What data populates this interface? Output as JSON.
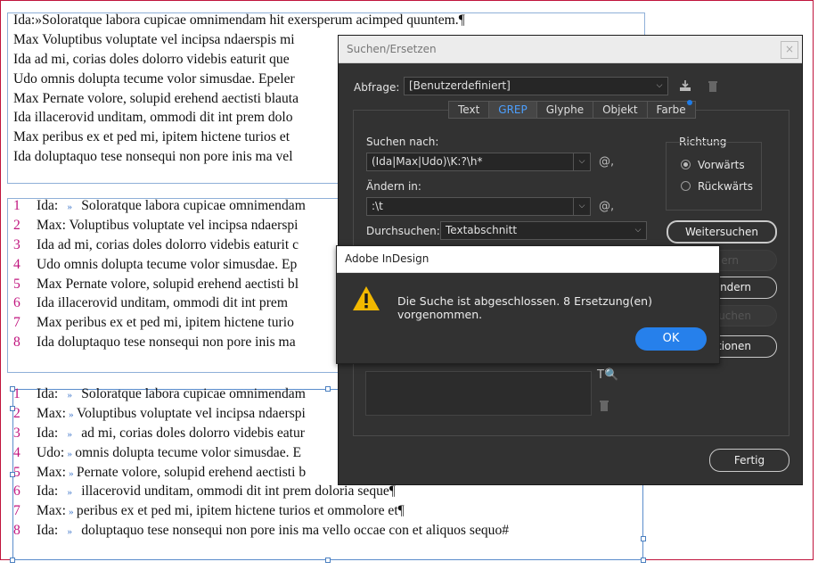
{
  "document": {
    "para1": [
      "Ida:»Soloratque labora cupicae omnimendam hit exersperum acimped quuntem.¶",
      "Max Voluptibus voluptate vel incipsa ndaerspis mi",
      "Ida ad mi, corias doles dolorro videbis eaturit que",
      "Udo omnis dolupta tecume volor simusdae. Epeler",
      "Max Pernate volore, solupid erehend aectisti blauta",
      "Ida illacerovid unditam, ommodi dit int prem dolo",
      "Max peribus ex et ped mi, ipitem hictene turios et",
      "Ida doluptaquo tese nonsequi non pore inis ma vel"
    ],
    "block2": [
      {
        "n": "1",
        "label": "Ida:",
        "tab": "»",
        "text": "Soloratque labora cupicae omnimendam"
      },
      {
        "n": "2",
        "label": "Max:",
        "tab": "",
        "text": "Voluptibus voluptate vel incipsa ndaerspi"
      },
      {
        "n": "3",
        "label": "Ida",
        "tab": "",
        "text": "ad mi, corias doles dolorro videbis eaturit c"
      },
      {
        "n": "4",
        "label": "Udo",
        "tab": "",
        "text": "omnis dolupta tecume volor simusdae. Ep"
      },
      {
        "n": "5",
        "label": "Max",
        "tab": "",
        "text": "Pernate volore, solupid erehend aectisti bl"
      },
      {
        "n": "6",
        "label": "Ida",
        "tab": "",
        "text": "illacerovid unditam, ommodi dit int prem"
      },
      {
        "n": "7",
        "label": "Max",
        "tab": "",
        "text": "peribus ex et ped mi, ipitem hictene turio"
      },
      {
        "n": "8",
        "label": "Ida",
        "tab": "",
        "text": "doluptaquo tese nonsequi non pore inis ma"
      }
    ],
    "block3": [
      {
        "n": "1",
        "label": "Ida:",
        "tab": "»",
        "text": "Soloratque labora cupicae omnimendam"
      },
      {
        "n": "2",
        "label": "Max:",
        "tab": "»",
        "text": "Voluptibus voluptate vel incipsa ndaerspi"
      },
      {
        "n": "3",
        "label": "Ida:",
        "tab": "»",
        "text": "ad mi, corias doles dolorro videbis eatur"
      },
      {
        "n": "4",
        "label": "Udo:",
        "tab": "»",
        "text": "omnis dolupta tecume volor simusdae. E"
      },
      {
        "n": "5",
        "label": "Max:",
        "tab": "»",
        "text": "Pernate volore, solupid erehend aectisti b"
      },
      {
        "n": "6",
        "label": "Ida:",
        "tab": "»",
        "text": "illacerovid unditam, ommodi dit int prem doloria seque¶"
      },
      {
        "n": "7",
        "label": "Max:",
        "tab": "»",
        "text": "peribus ex et ped mi, ipitem hictene turios et ommolore et¶"
      },
      {
        "n": "8",
        "label": "Ida:",
        "tab": "»",
        "text": "doluptaquo tese nonsequi non pore inis ma vello occae con et aliquos sequo#"
      }
    ]
  },
  "dialog": {
    "title": "Suchen/Ersetzen",
    "close": "×",
    "query_label": "Abfrage:",
    "query_value": "[Benutzerdefiniert]",
    "tabs": [
      "Text",
      "GREP",
      "Glyphe",
      "Objekt",
      "Farbe"
    ],
    "active_tab": "GREP",
    "search_label": "Suchen nach:",
    "search_value": "(Ida|Max|Udo)\\K:?\\h*",
    "replace_label": "Ändern in:",
    "replace_value": ":\\t",
    "scope_label": "Durchsuchen:",
    "scope_value": "Textabschnitt",
    "direction_label": "Richtung",
    "dir_forward": "Vorwärts",
    "dir_backward": "Rückwärts",
    "btn_find_next": "Weitersuchen",
    "btn_change_partial": "ndern",
    "btn_find_partial": "/Suchen",
    "btn_options_partial": "Optionen",
    "btn_done": "Fertig",
    "btn_hidden_partial": "ern"
  },
  "alert": {
    "title": "Adobe InDesign",
    "message": "Die Suche ist abgeschlossen. 8 Ersetzung(en) vorgenommen.",
    "ok": "OK"
  }
}
